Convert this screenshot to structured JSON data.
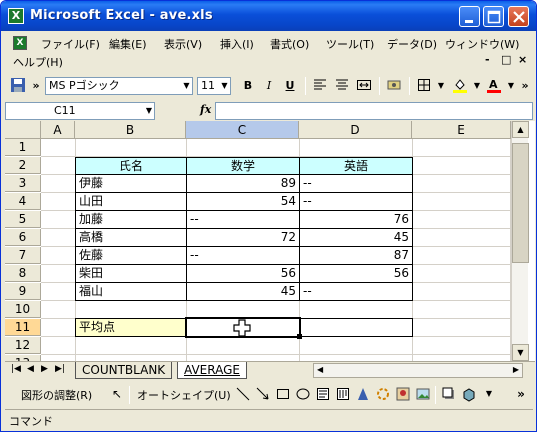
{
  "window": {
    "title": "Microsoft Excel - ave.xls",
    "app_icon": "excel-icon",
    "icon_glyph": "X"
  },
  "menu": {
    "items": [
      "ファイル(F)",
      "編集(E)",
      "表示(V)",
      "挿入(I)",
      "書式(O)",
      "ツール(T)",
      "データ(D)",
      "ウィンドウ(W)",
      "ヘルプ(H)"
    ],
    "doc_icon_glyph": "X",
    "controls": [
      "-",
      "□",
      "×"
    ]
  },
  "toolbar": {
    "font_name": "MS Pゴシック",
    "font_size": "11",
    "bold": "B",
    "italic": "I",
    "underline": "U",
    "overflow": "»"
  },
  "formula_bar": {
    "cell_ref": "C11",
    "fx_label": "fx",
    "value": ""
  },
  "sheet": {
    "columns": [
      "A",
      "B",
      "C",
      "D",
      "E"
    ],
    "active_column": "C",
    "rows": [
      "1",
      "2",
      "3",
      "4",
      "5",
      "6",
      "7",
      "8",
      "9",
      "10",
      "11",
      "12",
      "13"
    ],
    "active_row": "11",
    "table_header": {
      "name": "氏名",
      "math": "数学",
      "english": "英語"
    },
    "records": [
      {
        "name": "伊藤",
        "math": "89",
        "english": "--"
      },
      {
        "name": "山田",
        "math": "54",
        "english": "--"
      },
      {
        "name": "加藤",
        "math": "--",
        "english": "76"
      },
      {
        "name": "高橋",
        "math": "72",
        "english": "45"
      },
      {
        "name": "佐藤",
        "math": "--",
        "english": "87"
      },
      {
        "name": "柴田",
        "math": "56",
        "english": "56"
      },
      {
        "name": "福山",
        "math": "45",
        "english": "--"
      }
    ],
    "average_label": "平均点",
    "selected_cell": "C11"
  },
  "tabs": {
    "items": [
      "COUNTBLANK",
      "AVERAGE"
    ],
    "active": "AVERAGE"
  },
  "drawing": {
    "draw_menu": "図形の調整(R)",
    "autoshape_menu": "オートシェイプ(U)"
  },
  "status": {
    "text": "コマンド"
  }
}
